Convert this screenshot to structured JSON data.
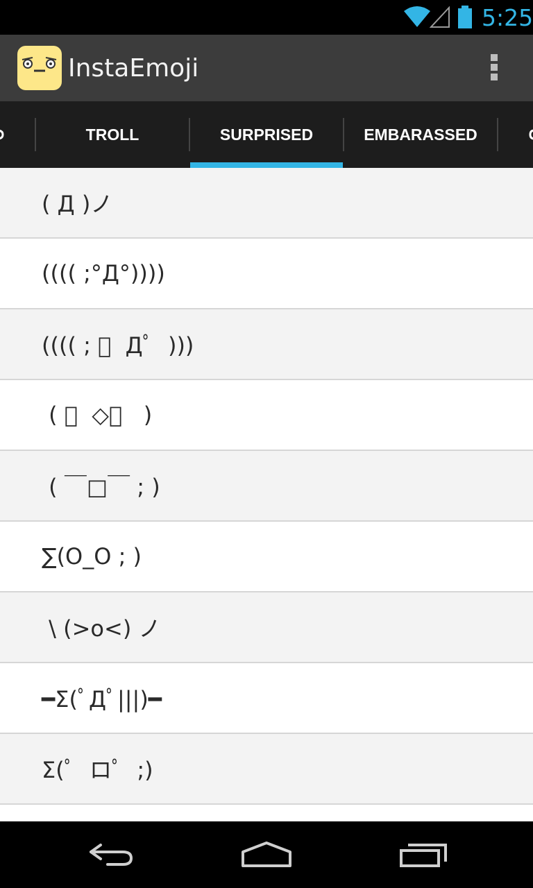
{
  "status_bar": {
    "time": "5:25",
    "accent_color": "#33b5e5",
    "icons": [
      "wifi-icon",
      "signal-icon",
      "battery-icon"
    ]
  },
  "action_bar": {
    "title": "InstaEmoji",
    "icon": "app-face-icon",
    "overflow": "overflow-menu-icon"
  },
  "tabs": [
    {
      "label": "TROLL",
      "selected": false
    },
    {
      "label": "SURPRISED",
      "selected": true
    },
    {
      "label": "EMBARASSED",
      "selected": false
    }
  ],
  "emojis": [
    "( Д )ノ",
    "(((( ;°Д°))))",
    "(((( ; ﾟ  Дﾟ  )))",
    " ( ﾟ  ◇ﾟ   )",
    " ( ￣□￣ ; )",
    "∑(O_O ; )",
    " \\ (>o<) ノ",
    "━Σ(ﾟДﾟ|||)━",
    "Σ(ﾟ  ロﾟ  ;)"
  ],
  "nav_bar": {
    "buttons": [
      "back-icon",
      "home-icon",
      "recents-icon"
    ]
  }
}
